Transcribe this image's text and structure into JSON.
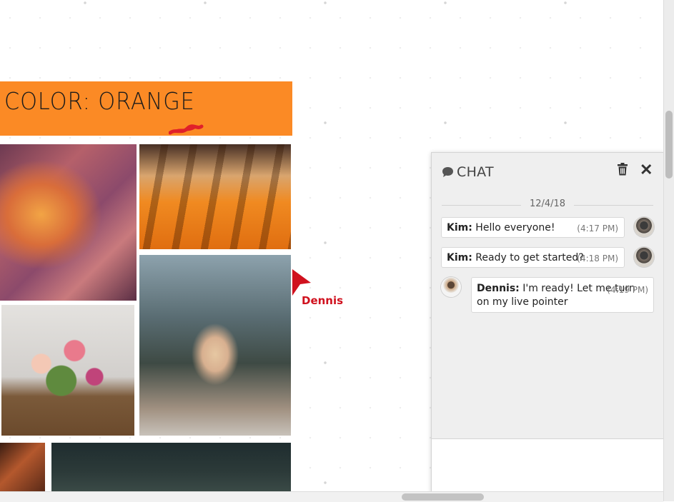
{
  "board": {
    "banner_title": "COLOR: ORANGE",
    "banner_color": "#fb8a25",
    "photos": [
      {
        "subject": "canyon"
      },
      {
        "subject": "orange-floor"
      },
      {
        "subject": "girl-headphones"
      },
      {
        "subject": "flower-basket"
      },
      {
        "subject": "fire"
      },
      {
        "subject": "dark-forest"
      }
    ],
    "live_pointer": {
      "user": "Dennis",
      "color": "#d0111e"
    }
  },
  "chat": {
    "title": "CHAT",
    "date": "12/4/18",
    "messages": [
      {
        "author": "Kim:",
        "text": "Hello everyone!",
        "time": "(4:17 PM)",
        "avatar": "kim-avatar"
      },
      {
        "author": "Kim:",
        "text": "Ready to get started?",
        "time": "(4:18 PM)",
        "avatar": "kim-avatar"
      },
      {
        "author": "Dennis:",
        "text": "I'm ready! Let me turn on my live pointer",
        "time": "(4:19 PM)",
        "avatar": "dennis-avatar"
      }
    ],
    "input_value": ""
  }
}
